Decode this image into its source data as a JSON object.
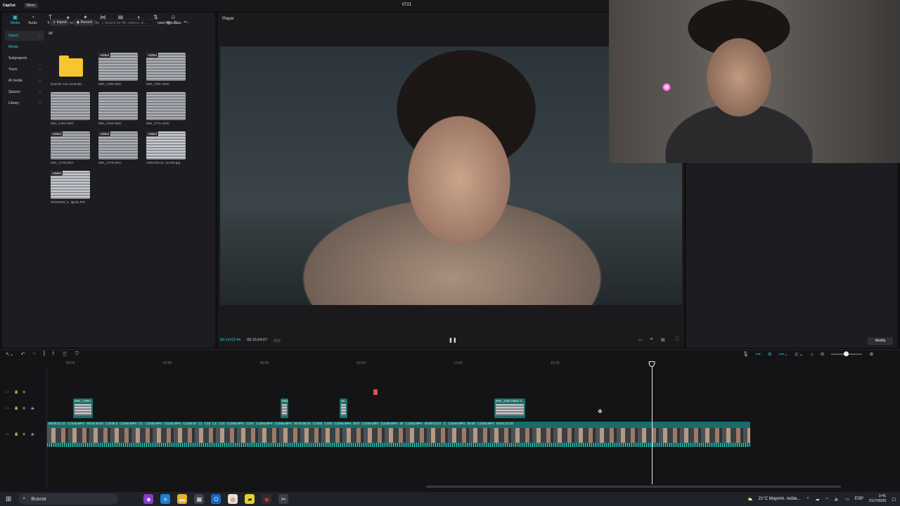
{
  "titlebar": {
    "logo": "CapCut",
    "menu": "Menu",
    "project_name": "0721"
  },
  "tabs": [
    {
      "label": "Media",
      "icon": "media-icon",
      "glyph": "▣"
    },
    {
      "label": "Audio",
      "icon": "audio-icon",
      "glyph": "◔"
    },
    {
      "label": "Text",
      "icon": "text-icon",
      "glyph": "T"
    },
    {
      "label": "Stickers",
      "icon": "stickers-icon",
      "glyph": "◕"
    },
    {
      "label": "Effects",
      "icon": "effects-icon",
      "glyph": "✦"
    },
    {
      "label": "Transitions",
      "icon": "transitions-icon",
      "glyph": "⋈"
    },
    {
      "label": "Captions",
      "icon": "captions-icon",
      "glyph": "▤"
    },
    {
      "label": "Filters",
      "icon": "filters-icon",
      "glyph": "◑"
    },
    {
      "label": "Adjustment",
      "icon": "adjustment-icon",
      "glyph": "⇅"
    },
    {
      "label": "AI avatars",
      "icon": "ai-avatars-icon",
      "glyph": "☺"
    }
  ],
  "side_nav": {
    "import": "Import",
    "media": "Media",
    "subprojects": "Subprojects",
    "yours": "Yours",
    "ai_media": "AI media",
    "spaces": "Spaces",
    "library": "Library"
  },
  "media_toolbar": {
    "import": "Import",
    "record": "Record",
    "search_placeholder": "Search for file, names, et..."
  },
  "all_label": "All",
  "media_items": [
    {
      "name": "leyendo mis comentar...",
      "added": false,
      "kind": "folder"
    },
    {
      "name": "IMG_1780.HEIC",
      "added": true,
      "kind": "screen"
    },
    {
      "name": "IMG_1781.HEIC",
      "added": true,
      "kind": "screen"
    },
    {
      "name": "IMG_1782.HEIC",
      "added": false,
      "kind": "screen"
    },
    {
      "name": "IMG_1783.HEIC",
      "added": false,
      "kind": "screen"
    },
    {
      "name": "IMG_1771.HEIC",
      "added": false,
      "kind": "screen"
    },
    {
      "name": "IMG_1778.HEIC",
      "added": true,
      "kind": "screen"
    },
    {
      "name": "IMG_1779.HEIC",
      "added": true,
      "kind": "screen"
    },
    {
      "name": "ASDASDAS...DASD.jpg",
      "added": true,
      "kind": "people"
    },
    {
      "name": "20160423_2...iginal.JPG",
      "added": true,
      "kind": "family"
    }
  ],
  "added_tag": "Added",
  "player": {
    "title": "Player",
    "time_current": "00:14:02:44",
    "time_total": "00:15:04:07"
  },
  "details": {
    "modify": "Modify"
  },
  "ruler_ticks": [
    "00:00",
    "03:00",
    "06:00",
    "09:00",
    "12:00",
    "15:00",
    "18:00"
  ],
  "overlay_clips": [
    {
      "label": "IMG_1780 I"
    },
    {
      "label": "IMG"
    },
    {
      "label": "20"
    },
    {
      "label": "IMG_1787.HEIC  0"
    }
  ],
  "main_track_labels": "00:00:31:41  C1045.MP4  00:00:40:53  C1045.5  C1045.MP4  C1  C1045.MP4  C1045.MP4  C1045.M  C1  C15  C1  C10  C1045.MP4  C104  C1045.MP4  C1045.MP4  00:00:00:15  C1045  C104  C1045.MP4  00:0  C1046.MP4  C1046.MP4  00  C1046.MP4  00:00:42:07  C  C1046.MP4  00:00  C1046.MP4  00:01:31:33",
  "taskbar": {
    "search": "Buscar",
    "weather": "21°C  Mayorm. nubla...",
    "lang": "ESP",
    "time": "3:41",
    "date": "21/7/2025"
  }
}
